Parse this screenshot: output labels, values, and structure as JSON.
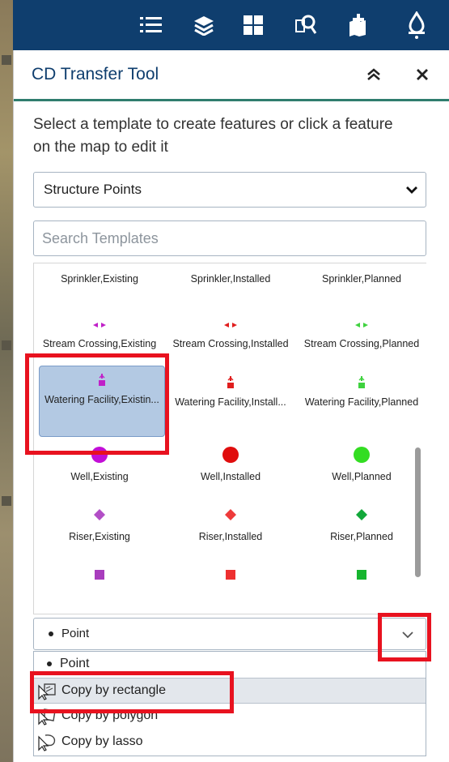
{
  "toolbar": {
    "icons": [
      "list-icon",
      "layers-icon",
      "grid-icon",
      "search-doc-icon",
      "edit-map-icon",
      "drop-icon"
    ]
  },
  "panel": {
    "title": "CD Transfer Tool",
    "instructions": "Select a template to create features or click a feature on the map to edit it",
    "layer_select": "Structure Points",
    "search_placeholder": "Search Templates"
  },
  "templates": [
    {
      "label": "Sprinkler,Existing",
      "symbol": "none"
    },
    {
      "label": "Sprinkler,Installed",
      "symbol": "none"
    },
    {
      "label": "Sprinkler,Planned",
      "symbol": "none"
    },
    {
      "label": "Stream Crossing,Existing",
      "symbol": "arrows",
      "color": "#c020c8"
    },
    {
      "label": "Stream Crossing,Installed",
      "symbol": "arrows",
      "color": "#e01e1e"
    },
    {
      "label": "Stream Crossing,Planned",
      "symbol": "arrows",
      "color": "#3fd23f"
    },
    {
      "label": "Watering Facility,Existin...",
      "symbol": "tap",
      "color": "#c020c8"
    },
    {
      "label": "Watering Facility,Install...",
      "symbol": "tap",
      "color": "#e01e1e"
    },
    {
      "label": "Watering Facility,Planned",
      "symbol": "tap",
      "color": "#3fd23f"
    },
    {
      "label": "Well,Existing",
      "symbol": "circle",
      "color": "#c20ed6"
    },
    {
      "label": "Well,Installed",
      "symbol": "circle",
      "color": "#e00d0d"
    },
    {
      "label": "Well,Planned",
      "symbol": "circle",
      "color": "#33dd22"
    },
    {
      "label": "Riser,Existing",
      "symbol": "diamond",
      "color": "#b24ec6"
    },
    {
      "label": "Riser,Installed",
      "symbol": "diamond",
      "color": "#ee3a3a"
    },
    {
      "label": "Riser,Planned",
      "symbol": "diamond",
      "color": "#12a83a"
    },
    {
      "label": "",
      "symbol": "square",
      "color": "#a83dbd"
    },
    {
      "label": "",
      "symbol": "square",
      "color": "#ee3030"
    },
    {
      "label": "",
      "symbol": "square",
      "color": "#17b52f"
    }
  ],
  "geometry": {
    "selected": "Point",
    "options": [
      "Point",
      "Copy by rectangle",
      "Copy by polygon",
      "Copy by lasso"
    ]
  }
}
